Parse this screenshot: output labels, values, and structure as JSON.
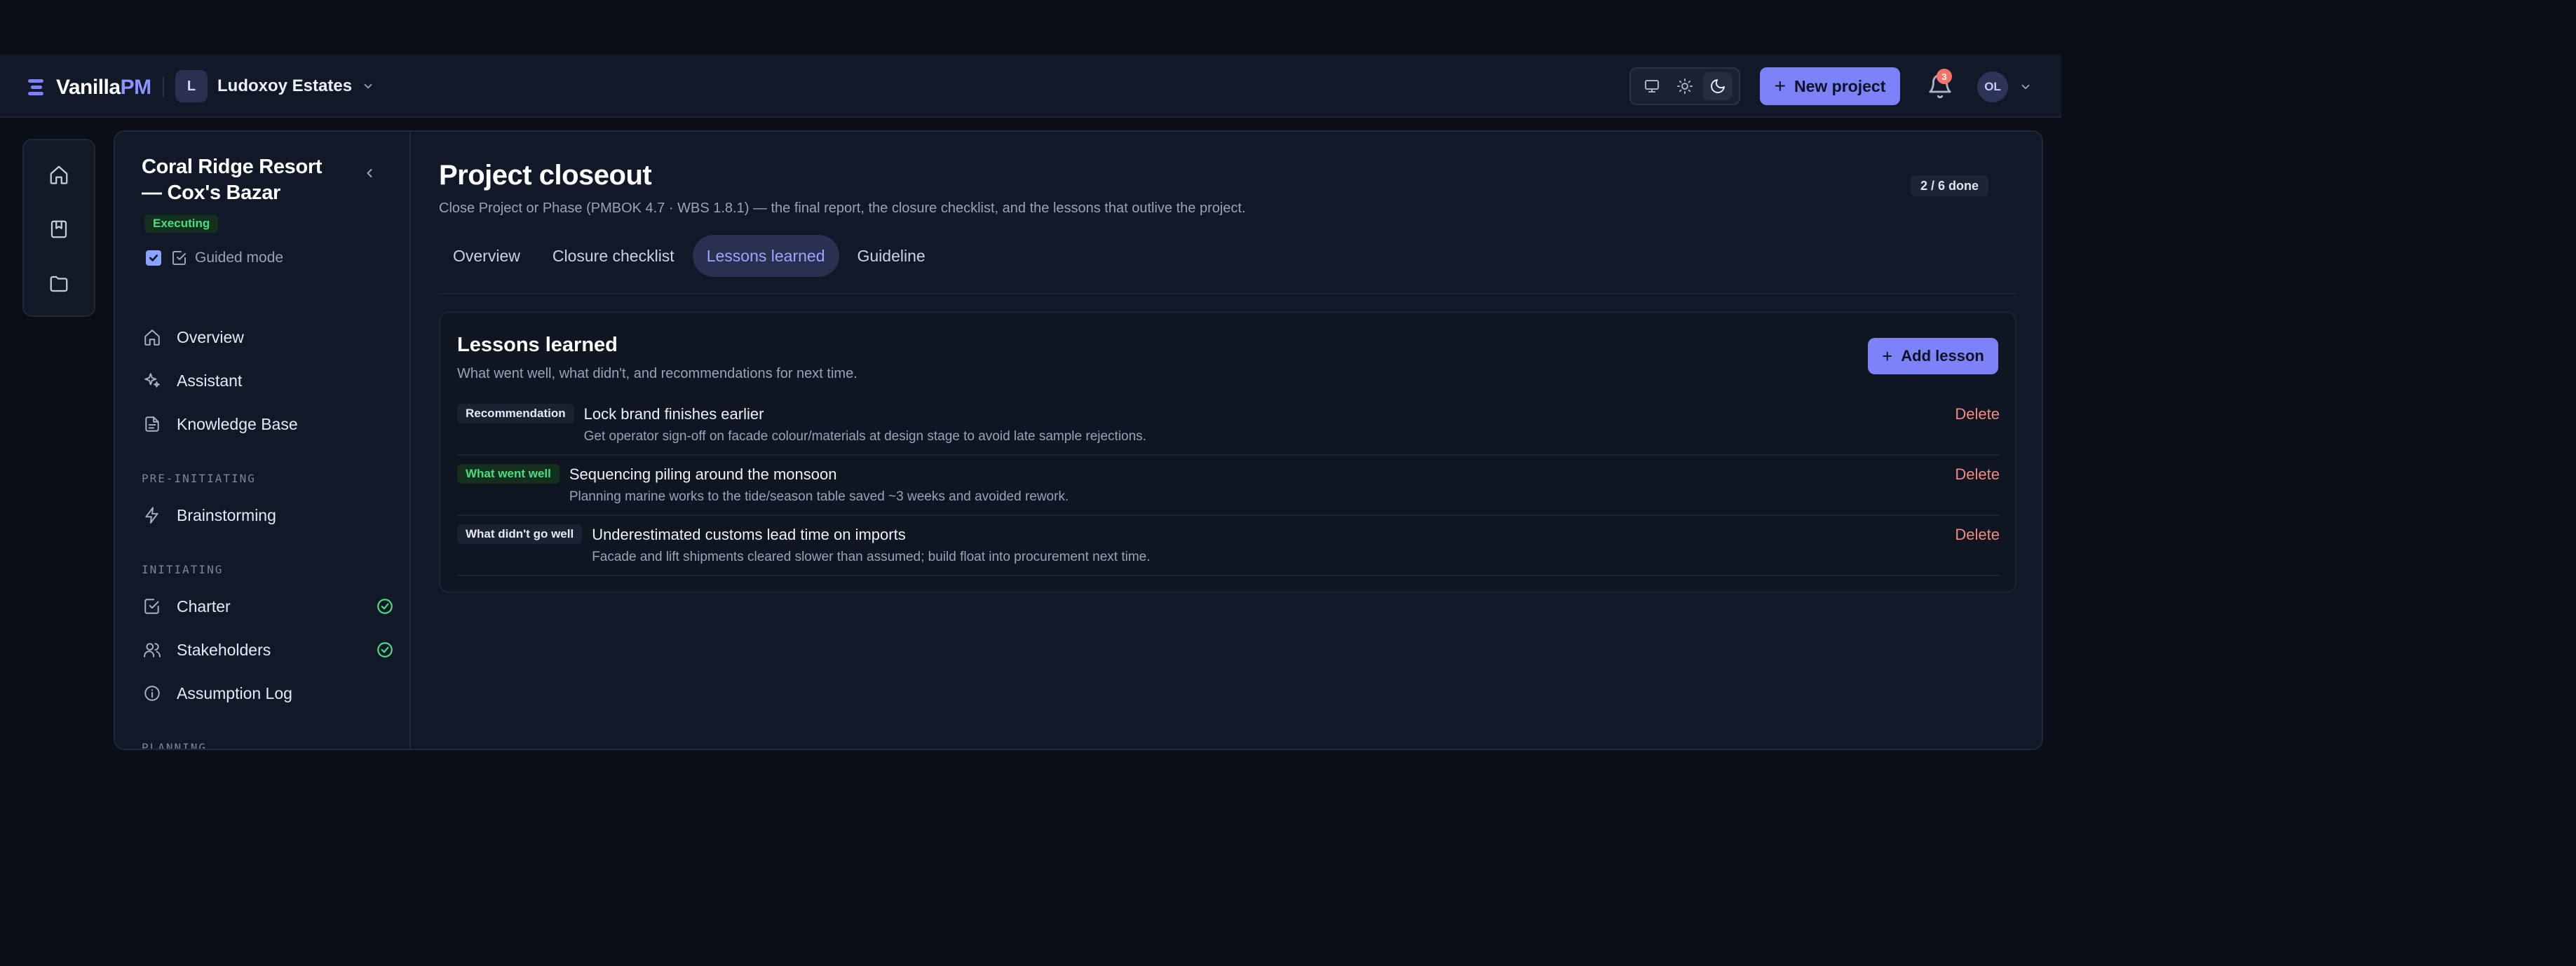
{
  "topbar": {
    "logo_main": "Vanilla",
    "logo_accent": "PM",
    "org_initial": "L",
    "org_name": "Ludoxoy Estates",
    "new_project_label": "New project",
    "notifications_count": "3",
    "user_initials": "OL"
  },
  "sidebar": {
    "project_title": "Coral Ridge Resort — Cox's Bazar",
    "status": "Executing",
    "guided_mode_label": "Guided mode",
    "items": [
      {
        "label": "Overview"
      },
      {
        "label": "Assistant"
      },
      {
        "label": "Knowledge Base"
      }
    ],
    "sections": {
      "pre_initiating": "PRE-INITIATING",
      "initiating": "INITIATING",
      "planning": "PLANNING"
    },
    "pre_items": [
      {
        "label": "Brainstorming"
      }
    ],
    "init_items": [
      {
        "label": "Charter",
        "done": true
      },
      {
        "label": "Stakeholders",
        "done": true
      },
      {
        "label": "Assumption Log",
        "done": false
      }
    ]
  },
  "main": {
    "title": "Project closeout",
    "subtitle": "Close Project or Phase (PMBOK 4.7 · WBS 1.8.1) — the final report, the closure checklist, and the lessons that outlive the project.",
    "progress": "2 / 6 done",
    "tabs": [
      {
        "label": "Overview"
      },
      {
        "label": "Closure checklist"
      },
      {
        "label": "Lessons learned"
      },
      {
        "label": "Guideline"
      }
    ],
    "active_tab": "Lessons learned"
  },
  "lessons_card": {
    "title": "Lessons learned",
    "subtitle": "What went well, what didn't, and recommendations for next time.",
    "add_label": "Add lesson",
    "delete_label": "Delete",
    "lessons": [
      {
        "tag": "Recommendation",
        "title": "Lock brand finishes earlier",
        "desc": "Get operator sign-off on facade colour/materials at design stage to avoid late sample rejections."
      },
      {
        "tag": "What went well",
        "title": "Sequencing piling around the monsoon",
        "desc": "Planning marine works to the tide/season table saved ~3 weeks and avoided rework."
      },
      {
        "tag": "What didn't go well",
        "title": "Underestimated customs lead time on imports",
        "desc": "Facade and lift shipments cleared slower than assumed; build float into procurement next time."
      }
    ]
  },
  "colors": {
    "accent": "#7c83f8",
    "success": "#4ade80",
    "danger": "#f28b82",
    "background": "#0a0e17",
    "surface": "#111827"
  }
}
